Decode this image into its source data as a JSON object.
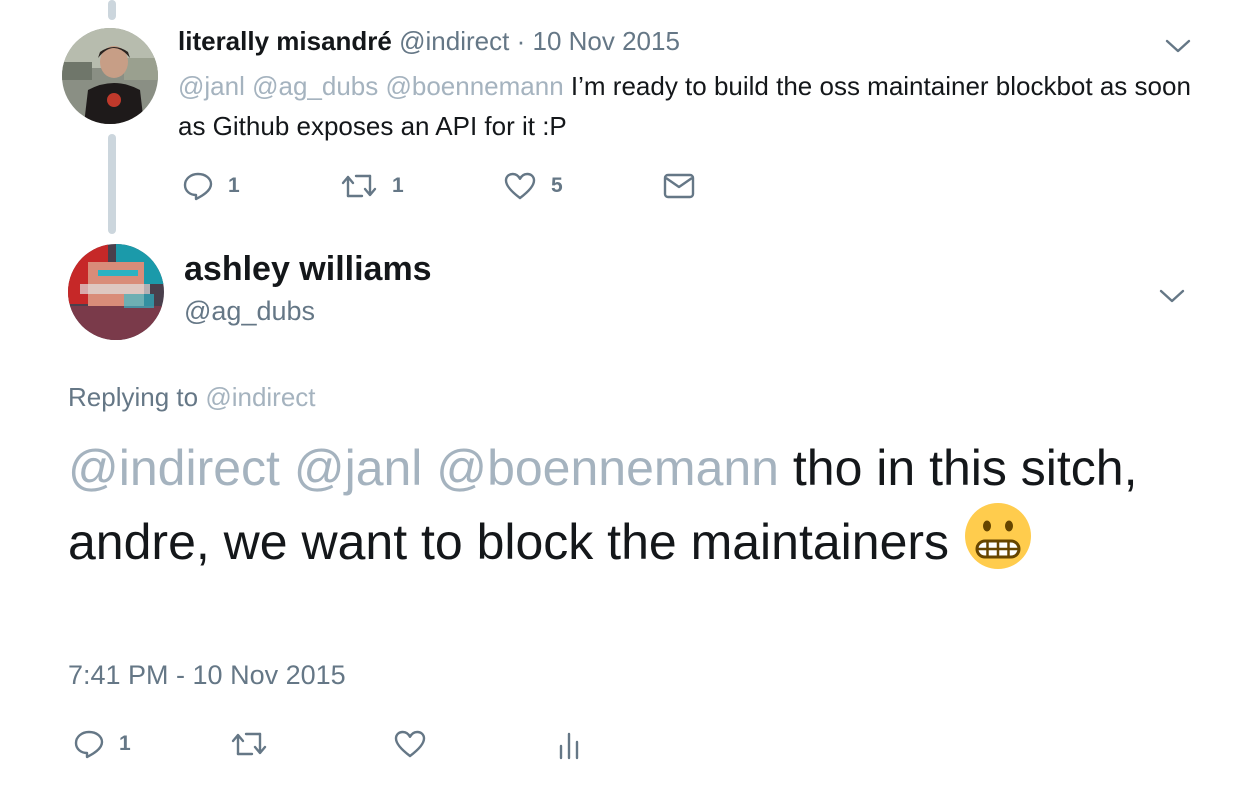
{
  "parent_tweet": {
    "display_name": "literally misandré",
    "handle": "@indirect",
    "separator": "·",
    "date": "10 Nov 2015",
    "mentions": "@janl @ag_dubs @boennemann",
    "text": "I’m ready to build the oss maintainer blockbot as soon as Github exposes an API for it :P",
    "reply_count": "1",
    "retweet_count": "1",
    "like_count": "5",
    "avatar_icon": "avatar-photo-icon",
    "caret_icon": "chevron-down-icon"
  },
  "main_tweet": {
    "display_name": "ashley williams",
    "handle": "@ag_dubs",
    "replying_prefix": "Replying to",
    "replying_handle": "@indirect",
    "mentions": "@indirect @janl @boennemann",
    "text": "tho in this sitch, andre, we want to block the maintainers",
    "emoji_icon": "grimacing-face-icon",
    "timestamp": "7:41 PM - 10 Nov 2015",
    "reply_count": "1",
    "avatar_icon": "avatar-photo-icon",
    "caret_icon": "chevron-down-icon"
  },
  "icons": {
    "reply": "reply-icon",
    "retweet": "retweet-icon",
    "like": "heart-icon",
    "message": "envelope-icon",
    "analytics": "analytics-icon"
  },
  "colors": {
    "text": "#14171a",
    "muted": "#657786",
    "mention": "#a5b3bf",
    "thread_line": "#ccd6dd",
    "emoji": "#ffcc4d"
  }
}
